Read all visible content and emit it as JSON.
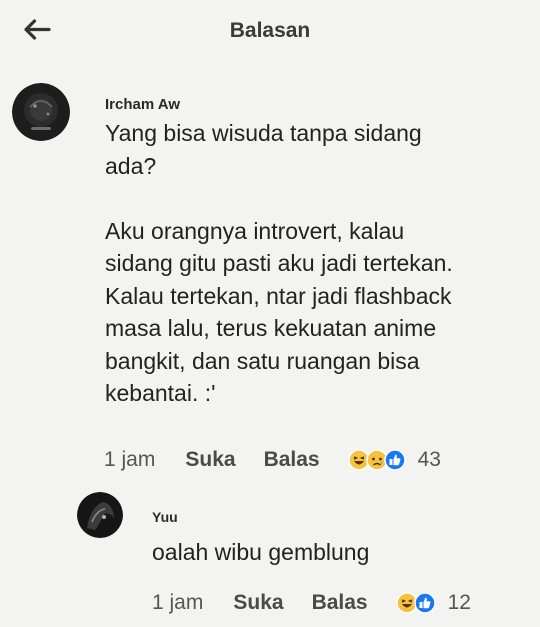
{
  "header": {
    "title": "Balasan"
  },
  "comment": {
    "author": "Ircham Aw",
    "text": "Yang bisa wisuda tanpa sidang\nada?\n\nAku orangnya introvert, kalau\nsidang gitu pasti aku jadi tertekan.\nKalau tertekan, ntar jadi flashback\nmasa lalu, terus kekuatan anime\nbangkit, dan satu ruangan bisa\nkebantai. :'",
    "time": "1 jam",
    "like_label": "Suka",
    "reply_label": "Balas",
    "reactions": [
      "haha-icon",
      "sad-icon",
      "like-icon"
    ],
    "reaction_count": "43"
  },
  "reply": {
    "author": "Yuu",
    "text": "oalah wibu gemblung",
    "time": "1 jam",
    "like_label": "Suka",
    "reply_label": "Balas",
    "reactions": [
      "haha-icon",
      "like-icon"
    ],
    "reaction_count": "12"
  },
  "colors": {
    "background": "#f3f3f1",
    "haha": "#f7c240",
    "like": "#1877f2"
  }
}
